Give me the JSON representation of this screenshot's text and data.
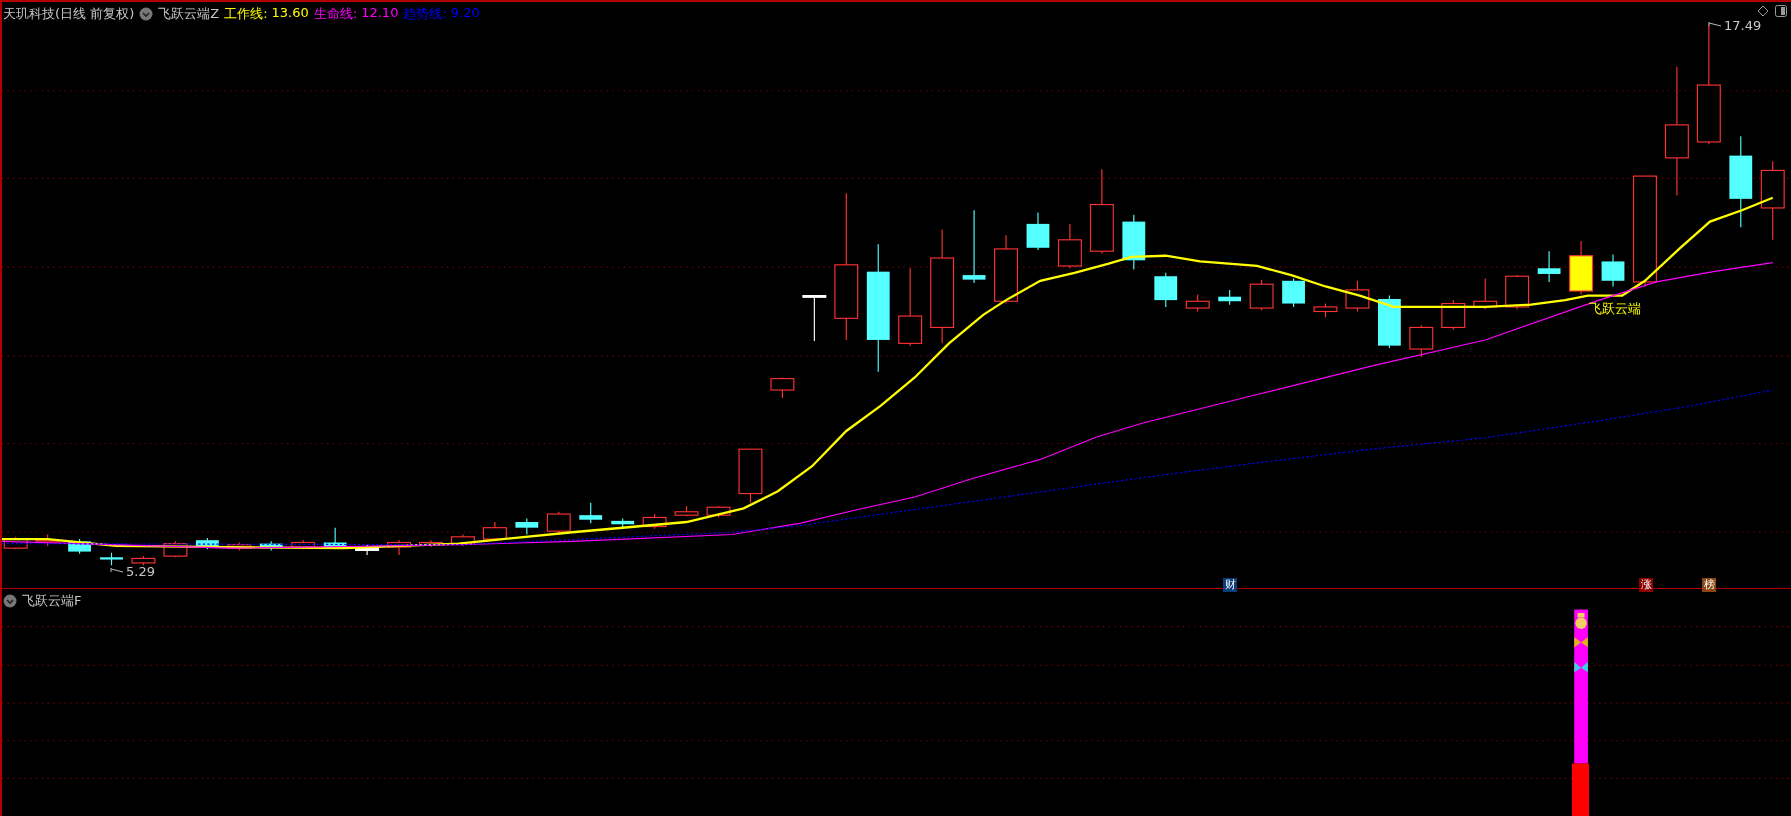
{
  "header": {
    "stock": "天玑科技(日线 前复权)",
    "indicator": "飞跃云端Z",
    "lines": [
      {
        "label": "工作线:",
        "value": "13.60",
        "color": "#ffff00"
      },
      {
        "label": "生命线:",
        "value": "12.10",
        "color": "#ff00ff"
      },
      {
        "label": "趋势线:",
        "value": "9.20",
        "color": "#0000ff"
      }
    ]
  },
  "main_chart": {
    "high_label": "17.49",
    "low_label": "5.29",
    "signal_label": "飞跃云端",
    "markers": [
      {
        "text": "财",
        "color": "#0a3d7a"
      },
      {
        "text": "涨",
        "color": "#8b0000"
      },
      {
        "text": "榜",
        "color": "#8b4513"
      }
    ]
  },
  "sub_chart": {
    "title": "飞跃云端F"
  }
}
